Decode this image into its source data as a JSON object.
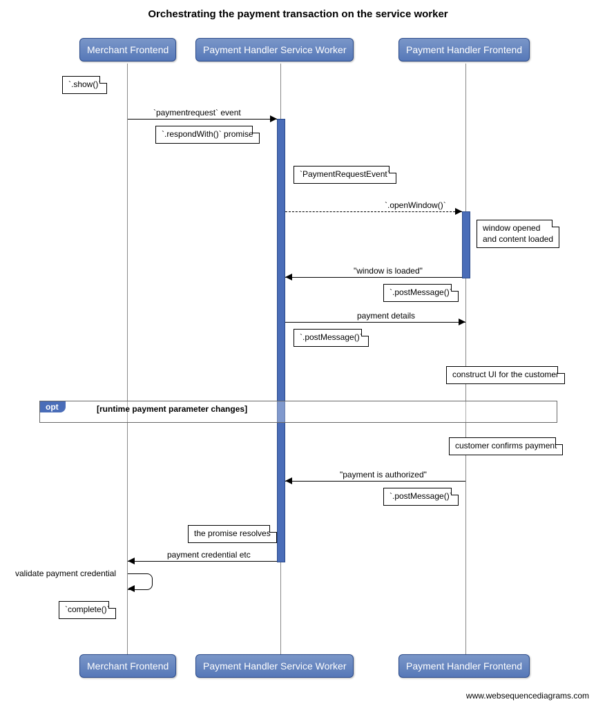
{
  "title": "Orchestrating the payment transaction on the service worker",
  "participants": {
    "p1": "Merchant Frontend",
    "p2": "Payment Handler Service Worker",
    "p3": "Payment Handler Frontend"
  },
  "notes": {
    "show": "`.show()`",
    "respondWith": "`.respondWith()` promise",
    "paymentRequestEvent": "`PaymentRequestEvent`",
    "windowOpened": "window opened\nand content loaded",
    "postMessage1": "`.postMessage()`",
    "postMessage2": "`.postMessage()`",
    "constructUI": "construct UI for the customer",
    "customerConfirms": "customer confirms payment",
    "postMessage3": "`.postMessage()`",
    "promiseResolves": "the promise resolves",
    "complete": "`complete()`"
  },
  "messages": {
    "paymentrequest": "`paymentrequest` event",
    "openWindow": "`.openWindow()`",
    "windowLoaded": "\"window is loaded\"",
    "paymentDetails": "payment details",
    "paymentAuthorized": "\"payment is authorized\"",
    "paymentCredential": "payment credential etc",
    "validate": "validate payment credential"
  },
  "frame": {
    "opt": "opt",
    "guard": "[runtime payment parameter changes]"
  },
  "footer": "www.websequencediagrams.com"
}
